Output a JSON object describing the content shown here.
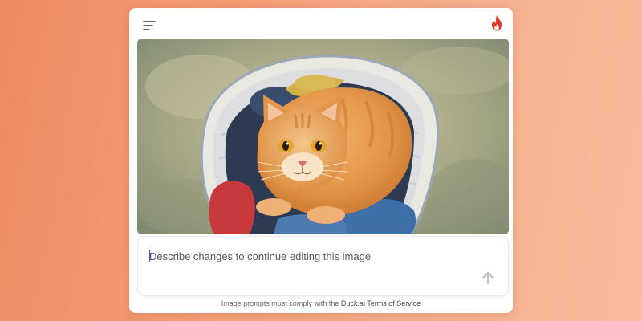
{
  "header": {
    "menu_icon": "hamburger-menu-icon",
    "brand_icon": "flame-icon",
    "brand_color": "#e5312a"
  },
  "image": {
    "subject": "watercolor-cat-in-laundry-basket"
  },
  "prompt": {
    "placeholder": "Describe changes to continue editing this image",
    "value": "",
    "send_icon": "arrow-up-icon"
  },
  "footer": {
    "text": "Image prompts must comply with the ",
    "link_label": "Duck.ai Terms of Service"
  },
  "colors": {
    "background_start": "#ef8a5f",
    "background_end": "#f8bc9e",
    "caret": "#3b5bdb"
  }
}
